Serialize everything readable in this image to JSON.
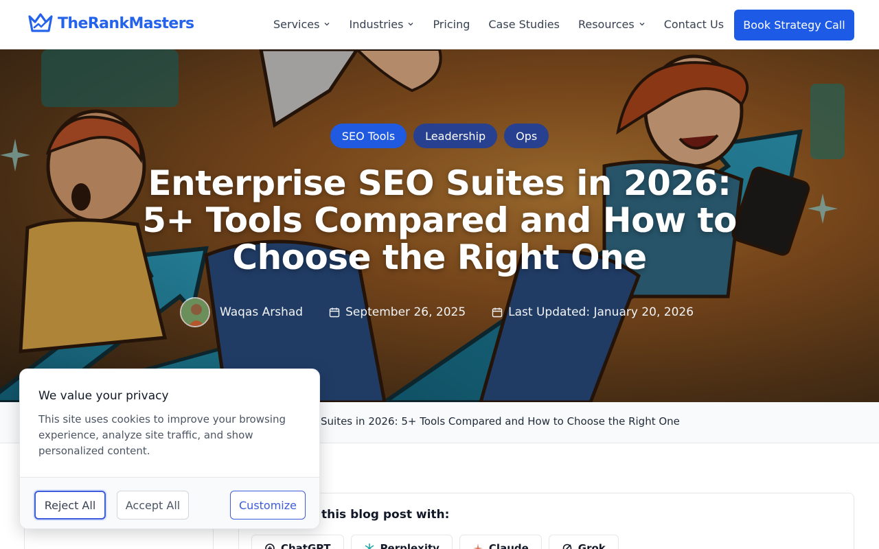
{
  "brand": {
    "name": "TheRankMasters",
    "accent": "#2563eb"
  },
  "nav": {
    "items": [
      {
        "label": "Services",
        "dropdown": true
      },
      {
        "label": "Industries",
        "dropdown": true
      },
      {
        "label": "Pricing",
        "dropdown": false
      },
      {
        "label": "Case Studies",
        "dropdown": false
      },
      {
        "label": "Resources",
        "dropdown": true
      },
      {
        "label": "Contact Us",
        "dropdown": false
      }
    ],
    "cta": "Book Strategy Call"
  },
  "hero": {
    "tags": [
      "SEO Tools",
      "Leadership",
      "Ops"
    ],
    "title": "Enterprise SEO Suites in 2026: 5+ Tools Compared and How to Choose the Right One",
    "author": "Waqas Arshad",
    "published": "September 26, 2025",
    "updated": "Last Updated: January 20, 2026"
  },
  "breadcrumb": {
    "current": "Suites in 2026: 5+ Tools Compared and How to Choose the Right One"
  },
  "summarize": {
    "title": "this blog post with:",
    "tools": [
      "ChatGPT",
      "Perplexity",
      "Claude",
      "Grok"
    ]
  },
  "cookie": {
    "title": "We value your privacy",
    "body": "This site uses cookies to improve your browsing experience, analyze site traffic, and show personalized content.",
    "reject": "Reject All",
    "accept": "Accept All",
    "customize": "Customize"
  }
}
